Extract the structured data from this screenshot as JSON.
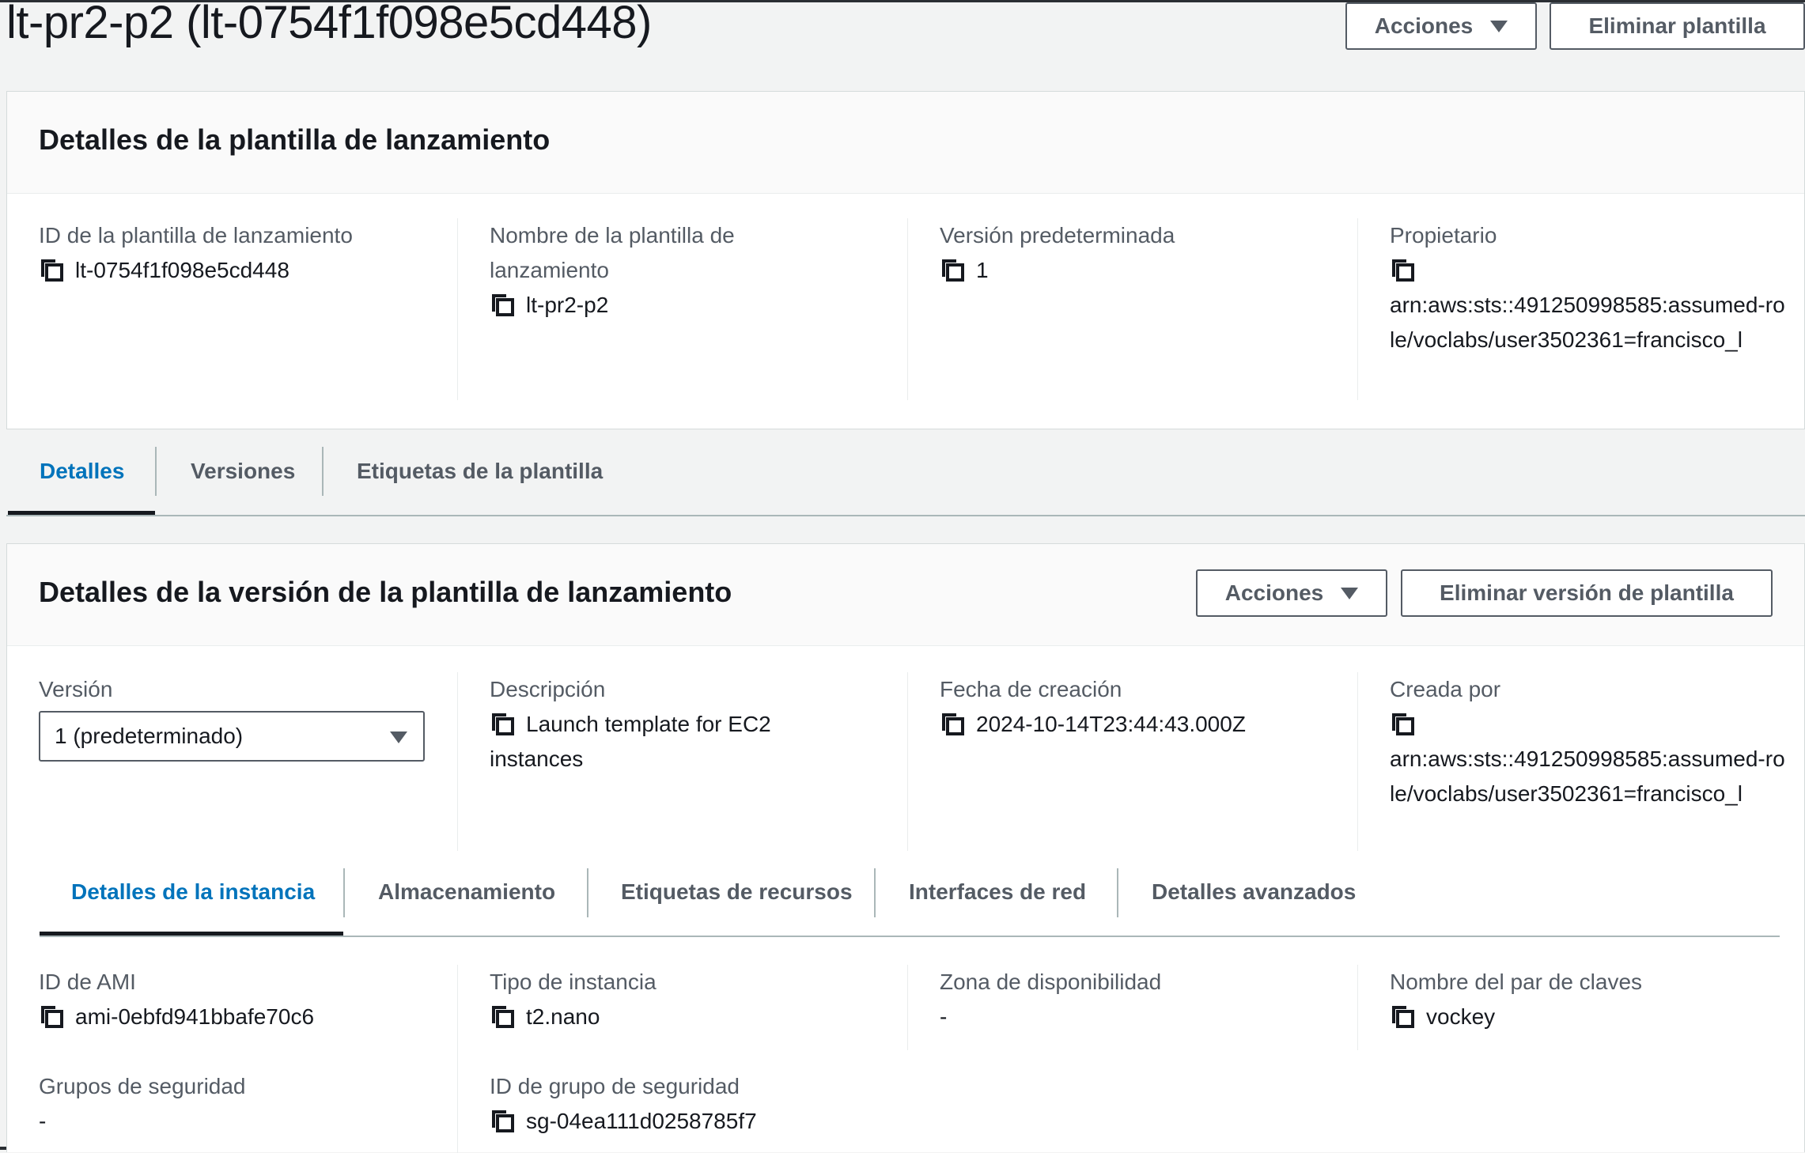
{
  "header": {
    "title": "lt-pr2-p2 (lt-0754f1f098e5cd448)",
    "actions_label": "Acciones",
    "delete_label": "Eliminar plantilla"
  },
  "template_details": {
    "title": "Detalles de la plantilla de lanzamiento",
    "fields": [
      {
        "label": "ID de la plantilla de lanzamiento",
        "value": "lt-0754f1f098e5cd448"
      },
      {
        "label": "Nombre de la plantilla de lanzamiento",
        "value": "lt-pr2-p2"
      },
      {
        "label": "Versión predeterminada",
        "value": "1"
      },
      {
        "label": "Propietario",
        "value": "arn:aws:sts::491250998585:assumed-role/voclabs/user3502361=francisco_l"
      }
    ]
  },
  "main_tabs": [
    {
      "label": "Detalles",
      "active": true
    },
    {
      "label": "Versiones",
      "active": false
    },
    {
      "label": "Etiquetas de la plantilla",
      "active": false
    }
  ],
  "version_details": {
    "title": "Detalles de la versión de la plantilla de lanzamiento",
    "actions_label": "Acciones",
    "delete_label": "Eliminar versión de plantilla",
    "version_label": "Versión",
    "version_selected": "1 (predeterminado)",
    "fields": [
      {
        "label": "Descripción",
        "value": "Launch template for EC2 instances"
      },
      {
        "label": "Fecha de creación",
        "value": "2024-10-14T23:44:43.000Z"
      },
      {
        "label": "Creada por",
        "value": "arn:aws:sts::491250998585:assumed-role/voclabs/user3502361=francisco_l"
      }
    ]
  },
  "sub_tabs": [
    {
      "label": "Detalles de la instancia",
      "active": true
    },
    {
      "label": "Almacenamiento",
      "active": false
    },
    {
      "label": "Etiquetas de recursos",
      "active": false
    },
    {
      "label": "Interfaces de red",
      "active": false
    },
    {
      "label": "Detalles avanzados",
      "active": false
    }
  ],
  "instance_details": {
    "ami_label": "ID de AMI",
    "ami_value": "ami-0ebfd941bbafe70c6",
    "type_label": "Tipo de instancia",
    "type_value": "t2.nano",
    "zone_label": "Zona de disponibilidad",
    "zone_value": "-",
    "key_label": "Nombre del par de claves",
    "key_value": "vockey",
    "sg_label": "Grupos de seguridad",
    "sg_value": "-",
    "sgid_label": "ID de grupo de seguridad",
    "sgid_value": "sg-04ea111d0258785f7"
  },
  "colors": {
    "accent": "#0073bb",
    "text": "#16191f",
    "muted": "#545b64"
  },
  "icons": [
    "copy-icon",
    "caret-down-icon"
  ]
}
